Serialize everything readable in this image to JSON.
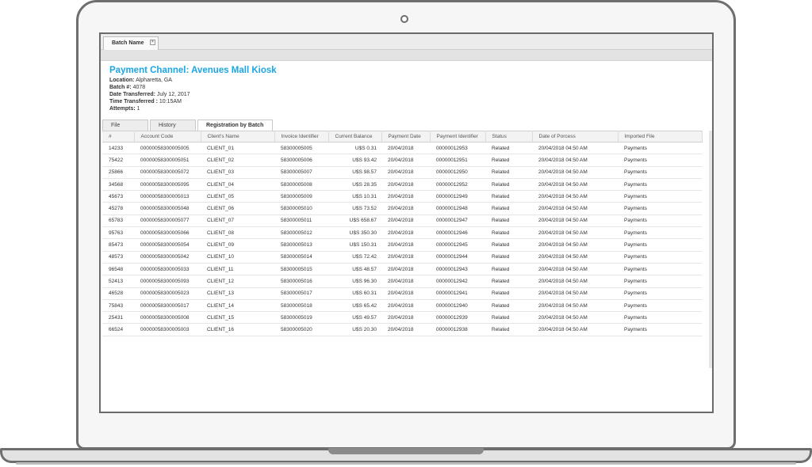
{
  "tab": {
    "title": "Batch Name",
    "close": "×"
  },
  "header": {
    "title": "Payment Channel: Avenues Mall Kiosk",
    "fields": [
      {
        "label": "Location:",
        "value": "Alpharetta, GA"
      },
      {
        "label": "Batch #:",
        "value": "4078"
      },
      {
        "label": "Date Transferred:",
        "value": "July 12, 2017"
      },
      {
        "label": "Time Transferred :",
        "value": "10:15AM"
      },
      {
        "label": "Attempts:",
        "value": "1"
      }
    ]
  },
  "subtabs": [
    "File",
    "History",
    "Registration by Batch"
  ],
  "table": {
    "columns": [
      "#",
      "Account Code",
      "Client's Name",
      "Invoice Identifier",
      "Current Balance",
      "Payment Date",
      "Payment Identifier",
      "Status",
      "Date of Porcess",
      "Imported File"
    ],
    "rows": [
      [
        "14233",
        "00000058300005005",
        "CLIENT_01",
        "58300005005",
        "U$S 0.31",
        "20/04/2018",
        "00000012953",
        "Related",
        "20/04/2018 04:50 AM",
        "Payments"
      ],
      [
        "75422",
        "00000058300005051",
        "CLIENT_02",
        "58300005006",
        "U$S 93.42",
        "20/04/2018",
        "00000012951",
        "Related",
        "20/04/2018 04:50 AM",
        "Payments"
      ],
      [
        "25866",
        "00000058300005072",
        "CLIENT_03",
        "58300005007",
        "U$S 98.57",
        "20/04/2018",
        "00000012950",
        "Related",
        "20/04/2018 04:50 AM",
        "Payments"
      ],
      [
        "34568",
        "00000058300005095",
        "CLIENT_04",
        "58300005008",
        "U$S 28.35",
        "20/04/2018",
        "00000012952",
        "Related",
        "20/04/2018 04:50 AM",
        "Payments"
      ],
      [
        "45673",
        "00000058300005013",
        "CLIENT_05",
        "58300005009",
        "U$S 10.31",
        "20/04/2018",
        "00000012949",
        "Related",
        "20/04/2018 04:50 AM",
        "Payments"
      ],
      [
        "45278",
        "00000058300005048",
        "CLIENT_06",
        "58300005010",
        "U$S 73.52",
        "20/04/2018",
        "00000012948",
        "Related",
        "20/04/2018 04:50 AM",
        "Payments"
      ],
      [
        "65783",
        "00000058300005077",
        "CLIENT_07",
        "58300005011",
        "U$S 658.67",
        "20/04/2018",
        "00000012947",
        "Related",
        "20/04/2018 04:50 AM",
        "Payments"
      ],
      [
        "95763",
        "00000058300005066",
        "CLIENT_08",
        "58300005012",
        "U$S 350.30",
        "20/04/2018",
        "00000012946",
        "Related",
        "20/04/2018 04:50 AM",
        "Payments"
      ],
      [
        "85473",
        "00000058300005054",
        "CLIENT_09",
        "58300005013",
        "U$S 150.31",
        "20/04/2018",
        "00000012945",
        "Related",
        "20/04/2018 04:50 AM",
        "Payments"
      ],
      [
        "48573",
        "00000058300005042",
        "CLIENT_10",
        "58300005014",
        "U$S 72.42",
        "20/04/2018",
        "00000012944",
        "Related",
        "20/04/2018 04:50 AM",
        "Payments"
      ],
      [
        "96548",
        "00000058300005033",
        "CLIENT_11",
        "58300005015",
        "U$S 48.57",
        "20/04/2018",
        "00000012943",
        "Related",
        "20/04/2018 04:50 AM",
        "Payments"
      ],
      [
        "52413",
        "00000058300005093",
        "CLIENT_12",
        "58300005016",
        "U$S 96.30",
        "20/04/2018",
        "00000012942",
        "Related",
        "20/04/2018 04:50 AM",
        "Payments"
      ],
      [
        "46528",
        "00000058300005023",
        "CLIENT_13",
        "58300005017",
        "U$S 60.31",
        "20/04/2018",
        "00000012941",
        "Related",
        "20/04/2018 04:50 AM",
        "Payments"
      ],
      [
        "75843",
        "00000058300005017",
        "CLIENT_14",
        "58300005018",
        "U$S 65.42",
        "20/04/2018",
        "00000012940",
        "Related",
        "20/04/2018 04:50 AM",
        "Payments"
      ],
      [
        "25431",
        "00000058300005008",
        "CLIENT_15",
        "58300005019",
        "U$S 49.57",
        "20/04/2018",
        "00000012939",
        "Related",
        "20/04/2018 04:50 AM",
        "Payments"
      ],
      [
        "66524",
        "00000058300005003",
        "CLIENT_16",
        "58300005020",
        "U$S 20.30",
        "20/04/2018",
        "00000012938",
        "Related",
        "20/04/2018 04:50 AM",
        "Payments"
      ]
    ]
  }
}
